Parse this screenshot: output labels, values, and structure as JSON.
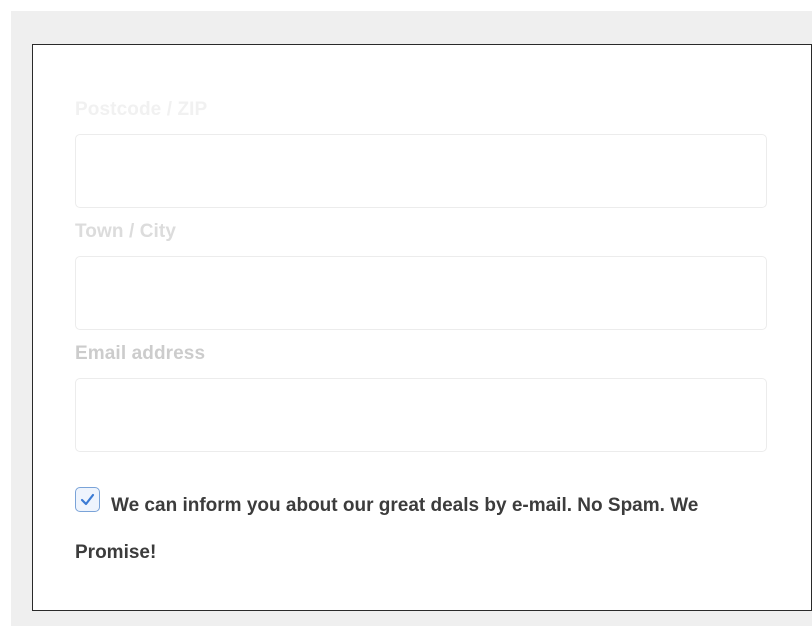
{
  "form": {
    "postcode": {
      "label": "Postcode / ZIP",
      "value": "",
      "placeholder": ""
    },
    "town": {
      "label": "Town / City",
      "value": "",
      "placeholder": ""
    },
    "email": {
      "label": "Email address",
      "value": "",
      "placeholder": ""
    },
    "newsletter": {
      "checked": true,
      "label": "We can inform you about our great deals by e-mail. No Spam. We Promise!"
    }
  },
  "colors": {
    "checkbox_accent": "#3b7bd4",
    "panel_border": "#2a2a2a",
    "backdrop": "#efefef"
  },
  "icons": {
    "checkbox": "checkmark-icon"
  }
}
